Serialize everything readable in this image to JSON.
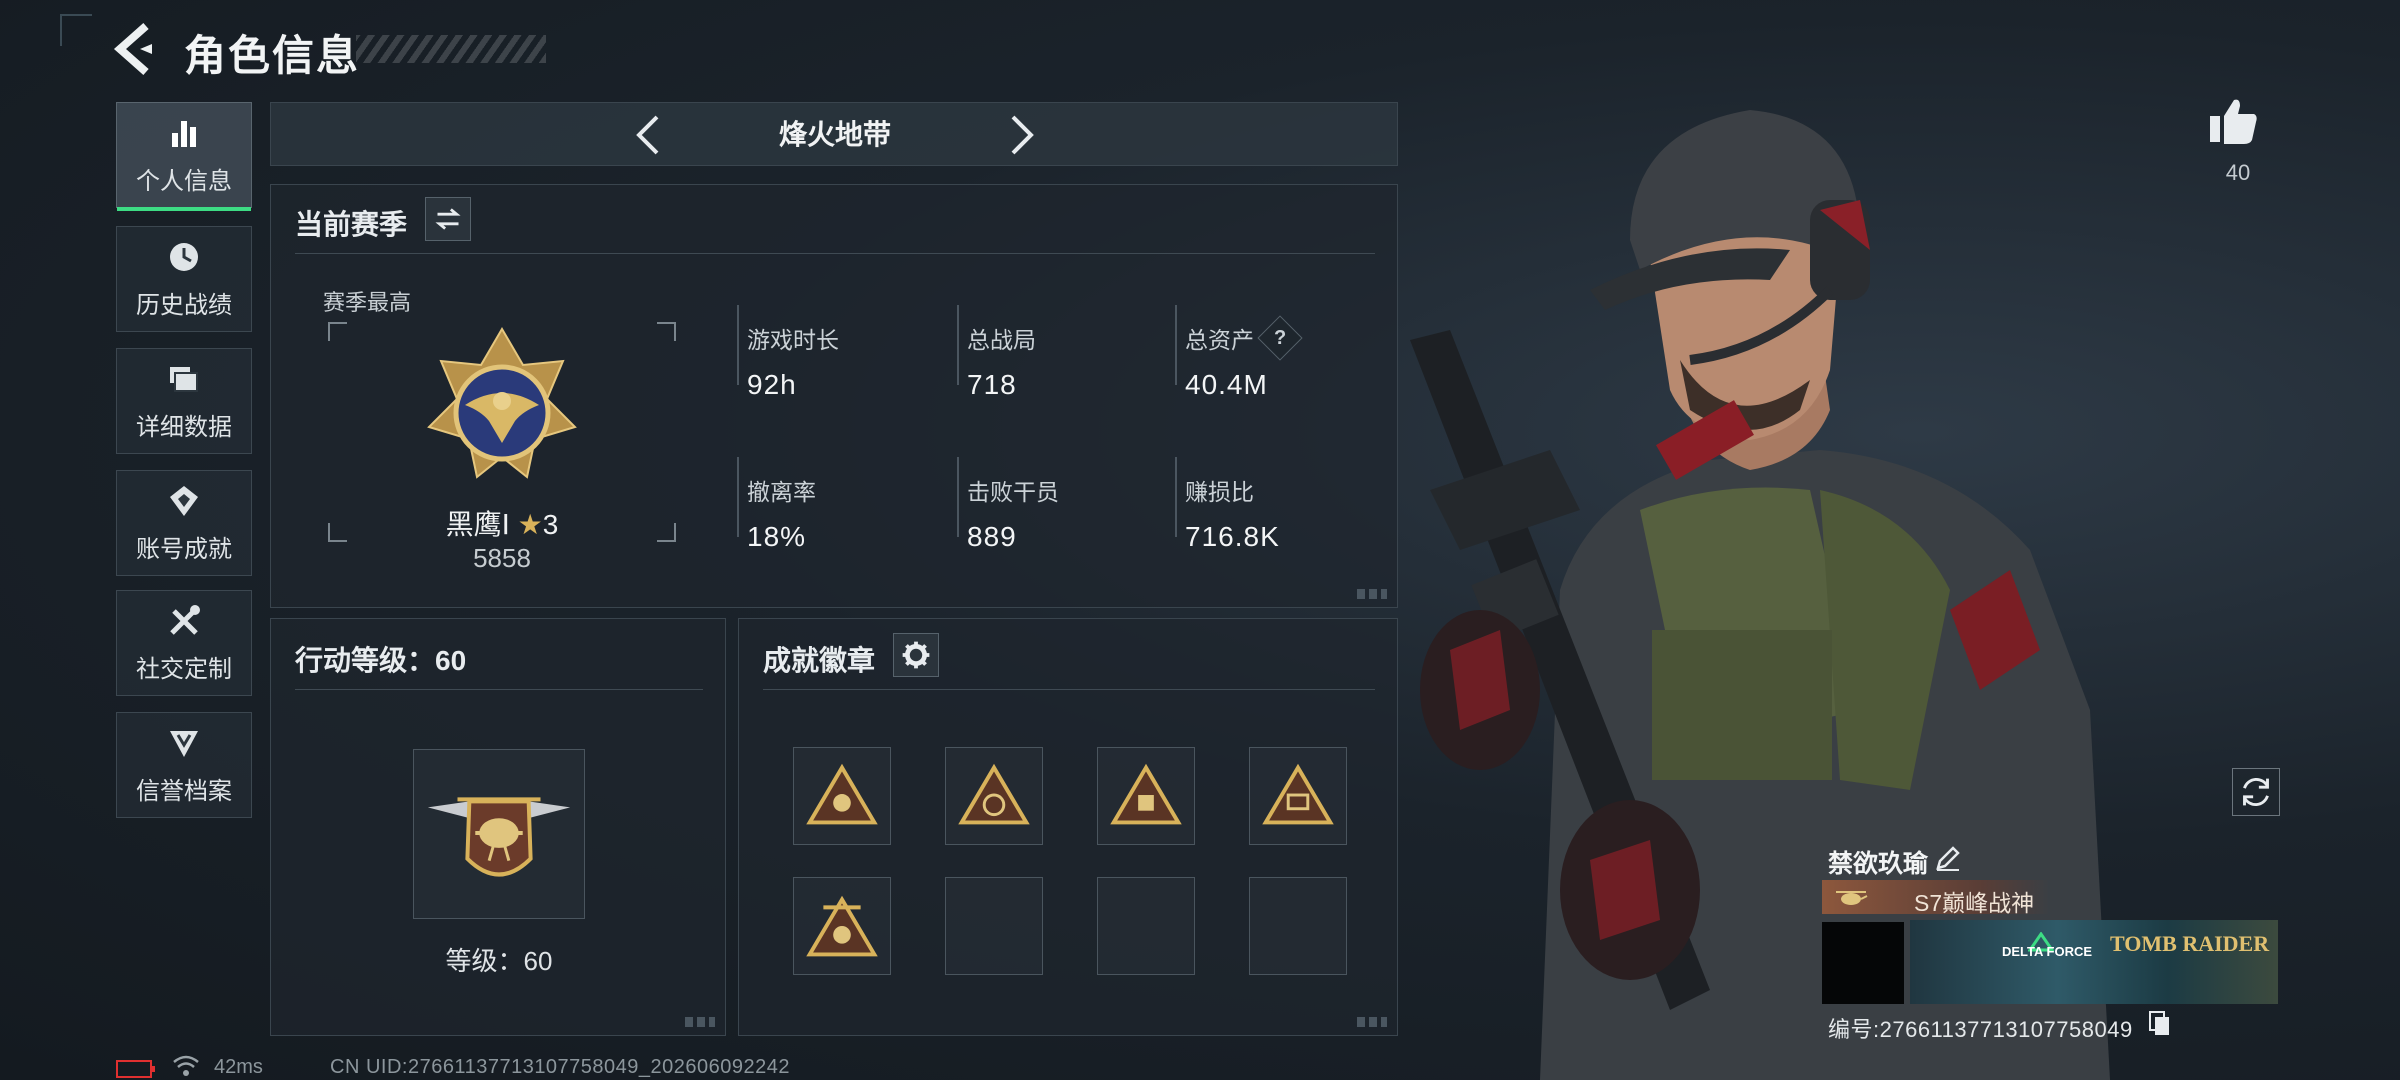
{
  "header": {
    "title": "角色信息",
    "back_icon": "back-arrow-icon"
  },
  "sidebar": {
    "items": [
      {
        "label": "个人信息",
        "icon": "bar-chart-icon",
        "active": true
      },
      {
        "label": "历史战绩",
        "icon": "history-clock-icon",
        "active": false
      },
      {
        "label": "详细数据",
        "icon": "folder-stack-icon",
        "active": false
      },
      {
        "label": "账号成就",
        "icon": "achievement-icon",
        "active": false
      },
      {
        "label": "社交定制",
        "icon": "tools-icon",
        "active": false
      },
      {
        "label": "信誉档案",
        "icon": "shield-badge-icon",
        "active": false
      }
    ]
  },
  "mode_selector": {
    "label": "烽火地带"
  },
  "season": {
    "header": "当前赛季",
    "best_label": "赛季最高",
    "rank_name": "黑鹰Ⅰ",
    "rank_stars": "3",
    "rank_score": "5858",
    "stats": [
      {
        "label": "游戏时长",
        "value": "92h"
      },
      {
        "label": "总战局",
        "value": "718"
      },
      {
        "label": "总资产",
        "value": "40.4M",
        "help": "?"
      },
      {
        "label": "撤离率",
        "value": "18%"
      },
      {
        "label": "击败干员",
        "value": "889"
      },
      {
        "label": "赚损比",
        "value": "716.8K"
      }
    ]
  },
  "action_level": {
    "title": "行动等级：60",
    "level_text": "等级：60"
  },
  "badges": {
    "title": "成就徽章",
    "filled": 5,
    "total": 8
  },
  "profile": {
    "like_count": "40",
    "player_name": "禁欲玖瑜",
    "title": "S7巅峰战神",
    "banner_logo_left": "DELTA FORCE",
    "banner_logo_right": "TOMB RAIDER",
    "player_id": "编号:2766113771310775804​9",
    "player_id_clean": "编号:27661137713107758049"
  },
  "footer": {
    "ping": "42ms",
    "uid": "CN UID:27661137713107758049_202606092242"
  },
  "colors": {
    "accent_green": "#3ddc84",
    "gold": "#d8b25a",
    "panel_bg": "#1e262e",
    "battery_red": "#e03030"
  }
}
